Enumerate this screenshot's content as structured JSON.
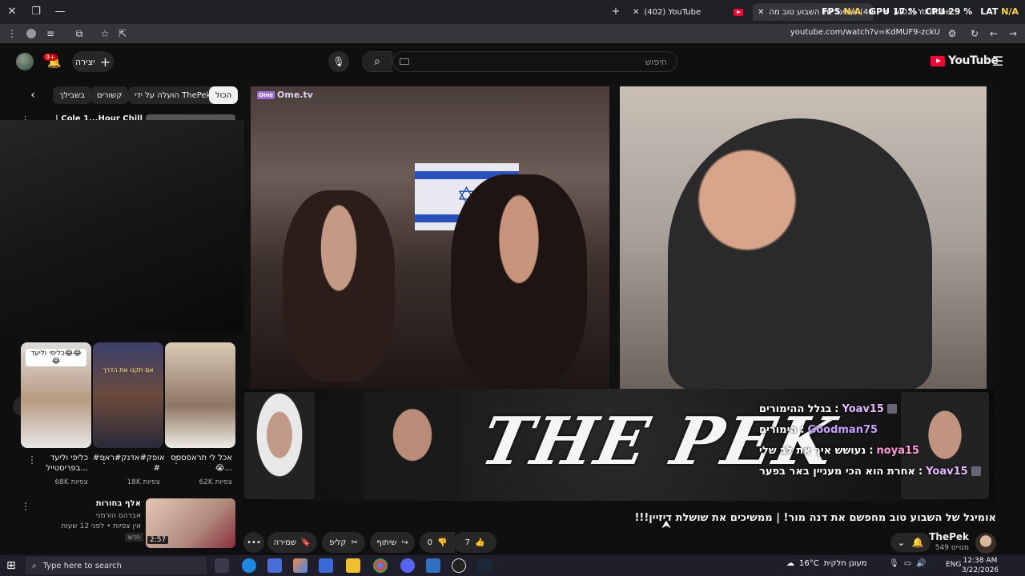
{
  "browser": {
    "tabs": [
      {
        "label": "(402) YouTube"
      },
      {
        "label": "(402) אומיגל של השבוע טוב מה"
      },
      {
        "label": "(402) YouTube"
      }
    ],
    "url": "youtube.com/watch?v=KdMUF9-zckU",
    "new_tab": "+",
    "close": "✕"
  },
  "overlay_stats": {
    "fps_label": "FPS",
    "fps_value": "N/A",
    "gpu_label": "GPU",
    "gpu_value": "17 %",
    "cpu_label": "CPU",
    "cpu_value": "29 %",
    "lat_label": "LAT",
    "lat_value": "N/A"
  },
  "header": {
    "logo_text": "YouTube",
    "search_placeholder": "חיפוש",
    "create_label": "יצירה",
    "notifications_badge": "9+"
  },
  "chips": [
    "הכול",
    "הועלה על ידי ThePek",
    "קשורים",
    "בשבילך"
  ],
  "related_top": {
    "title": "| Cole 1...Hour Chill Songs"
  },
  "shorts": [
    {
      "title": "אכל לי תראסססס 😭...",
      "views": "62K צפיות"
    },
    {
      "title": "#אופק#אדנק#ראפ #",
      "views": "18K צפיות"
    },
    {
      "title": "כליפי וליעד בפריסטייל...",
      "views": "68K צפיות"
    }
  ],
  "short_overlays": [
    "כליפי וליעד😂😂😂",
    "אם תקנו את הדרך"
  ],
  "related": {
    "title": "אלף בחורות",
    "channel": "אברהם הורמני",
    "meta": "אין צפיות • לפני 12 שעות",
    "badge": "חדש",
    "duration": "2:57"
  },
  "player": {
    "brand_text": "Ome.tv",
    "brand_box": "Ome",
    "logo_overlay": "THE PEK",
    "chat": [
      {
        "user": "Yoav15",
        "msg": "בגלל ההימורים",
        "color": "#e6b9ff"
      },
      {
        "user": "Goodman75",
        "msg": "הימורים",
        "color": "#c9a0ff"
      },
      {
        "user": "noya15",
        "msg": "נעושש איך את לב שלי",
        "color": "#ff9ad5"
      },
      {
        "user": "Yoav15",
        "msg": "אחרת הוא הכי מעניין באר בפער",
        "color": "#e6b9ff"
      }
    ]
  },
  "video": {
    "title": "אומיגל של השבוע טוב מחפשם את דנה מור! | ממשיכים את שושלת דיזיין!!!",
    "channel": "ThePek",
    "subs": "549 מנויים",
    "likes": "7",
    "dislikes": "0",
    "share_label": "שיתוף",
    "clip_label": "קליפ",
    "save_label": "שמירה",
    "more": "•••"
  },
  "taskbar": {
    "search_placeholder": "Type here to search",
    "weather_temp": "16°C",
    "weather_desc": "מעונן חלקית",
    "lang": "ENG",
    "time": "12:38 AM",
    "date": "3/22/2026"
  },
  "colors": {
    "accent": "#ff0033",
    "background": "#0f0f0f",
    "chip": "#272727"
  }
}
